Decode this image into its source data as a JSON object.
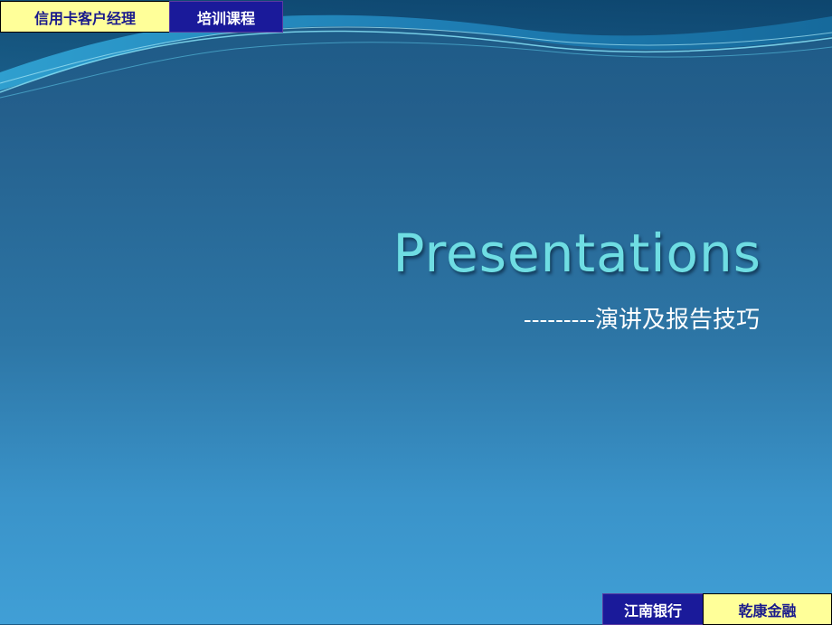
{
  "header": {
    "left_tag": "信用卡客户经理",
    "right_tag": "培训课程"
  },
  "slide": {
    "title": "Presentations",
    "subtitle": "---------演讲及报告技巧"
  },
  "footer": {
    "left_tag": "江南银行",
    "right_tag": "乾康金融"
  },
  "colors": {
    "yellow_tag": "#ffff99",
    "blue_tag": "#1a1a9a",
    "title_color": "#6fdde3",
    "background_top": "#1c5a86",
    "background_bottom": "#409fd6"
  }
}
